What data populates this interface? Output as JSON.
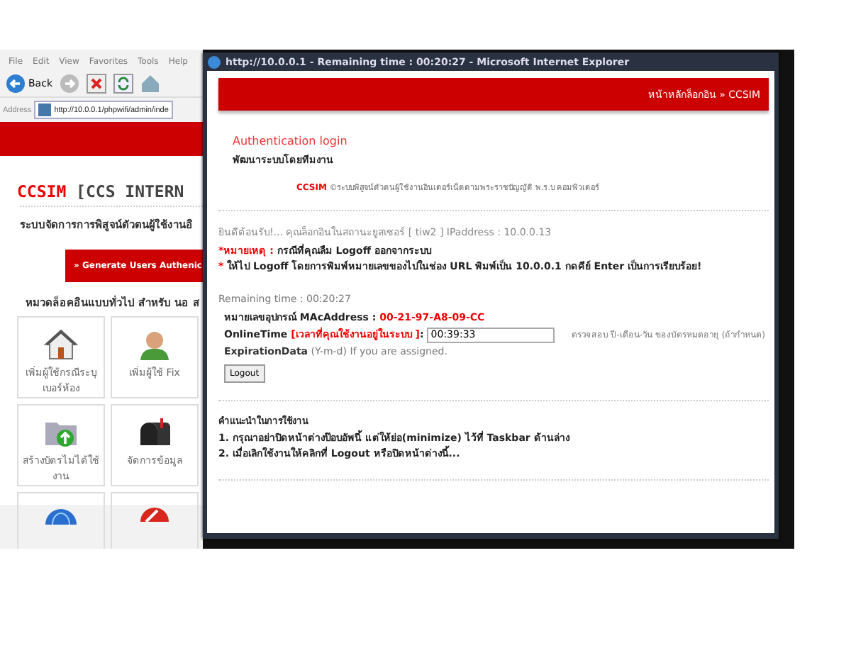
{
  "back_window": {
    "menu": [
      "File",
      "Edit",
      "View",
      "Favorites",
      "Tools",
      "Help"
    ],
    "toolbar": {
      "back_label": "Back"
    },
    "address": {
      "label": "Address",
      "value": "http://10.0.0.1/phpwifi/admin/inde"
    },
    "title_brand": "CCSIM",
    "title_rest": "[CCS INTERN",
    "subtitle": "ระบบจัดการการพิสูจน์ตัวตนผู้ใช้งานอิ",
    "generate_button": "» Generate Users Authenic",
    "section": "หมวดล็อคอินแบบทั่วไป สำหรับ นอ ส",
    "tiles": [
      {
        "kind": "house",
        "label": "เพิ่มผู้ใช้กรณีระบุ เบอร์ห้อง"
      },
      {
        "kind": "person",
        "label": "เพิ่มผู้ใช้ Fix"
      },
      {
        "kind": "folder",
        "label": "สร้างบัตรไม่ได้ใช้ งาน"
      },
      {
        "kind": "mailbox",
        "label": "จัดการข้อมูล"
      },
      {
        "kind": "globe"
      },
      {
        "kind": "forbidden"
      }
    ]
  },
  "popup": {
    "title": "http://10.0.0.1 - Remaining time : 00:20:27 - Microsoft Internet Explorer",
    "breadcrumb": "หน้าหลักล็อกอิน » CCSIM",
    "heading": "Authentication login",
    "team": "พัฒนาระบบโดยทีมงาน",
    "brand": "CCSIM",
    "brand_text": "©ระบบพิสูจน์ตัวตนผู้ใช้งานอินเตอร์เน็ตตามพระราชบัญญัติ พ.ร.บ คอมพิวเตอร์",
    "welcome": "ยินดีต้อนรับ!... คุณล็อกอินในสถานะยูสเซอร์ [ tiw2 ]  IPaddress : 10.0.0.13",
    "note_label": "*หมายเหตุ :",
    "note": "กรณีที่คุณลืม Logoff ออกจากระบบ",
    "note2_mark": "*",
    "note2": "ให้ไป Logoff โดยการพิมพ์หมายเลขของไปในช่อง URL พิมพ์เป็น 10.0.0.1 กดคีย์ Enter เป็นการเรียบร้อย!",
    "remaining": "Remaining time : 00:20:27",
    "mac_label": "หมายเลขอุปกรณ์ MAcAddress :",
    "mac": "00-21-97-A8-09-CC",
    "online_label": "OnlineTime",
    "online_hint": "[เวลาที่คุณใช้งานอยู่ในระบบ ]",
    "online_colon": ":",
    "online_value": "00:39:33",
    "check_text": "ตรวจสอบ ปี-เดือน-วัน ของบัตรหมดอายุ (ถ้ากำหนด)",
    "exp_label": "ExpirationData",
    "exp_text": "(Y-m-d) If you are assigned.",
    "logout_button": "Logout",
    "advice_title": "คำแนะนำในการใช้งาน",
    "advice": [
      "1. กรุณาอย่าปิดหน้าต่างป๊อบอัพนี้ แต่ให้ย่อ(minimize) ไว้ที่ Taskbar ด้านล่าง",
      "2. เมื่อเลิกใช้งานให้คลิกที่ Logout หรือปิดหน้าต่างนี้..."
    ]
  }
}
